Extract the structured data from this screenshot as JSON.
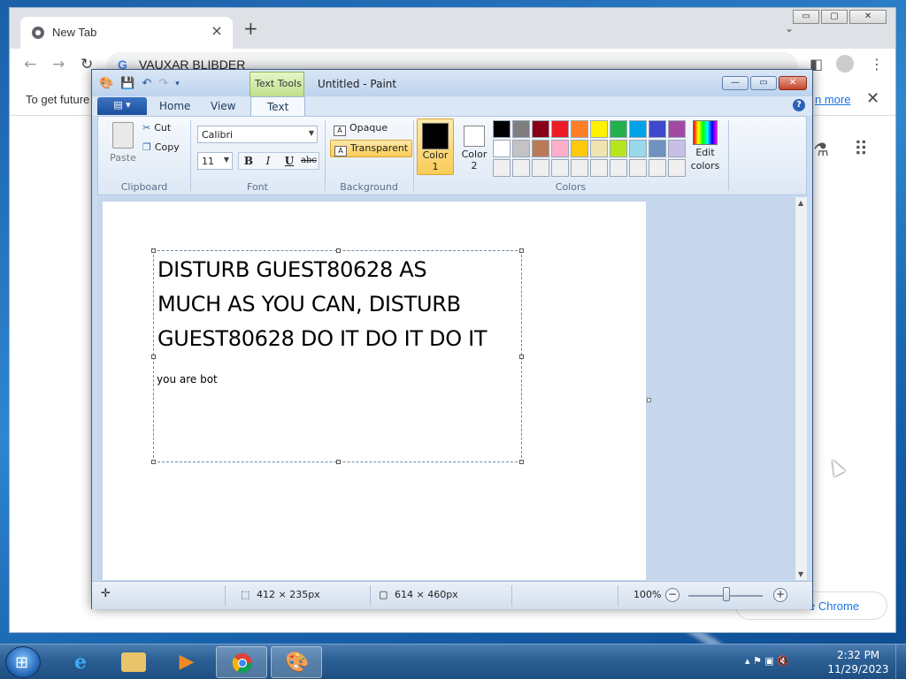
{
  "chrome": {
    "tab_title": "New Tab",
    "tab_close": "×",
    "new_tab": "+",
    "tab_search": "⌄",
    "window_controls": [
      "▭",
      "▢",
      "✕"
    ],
    "omnibox_text": "VAUXAR BLIBDER",
    "omnibox_icon": "G",
    "infobar_text": "To get future",
    "infobar_link": "n more",
    "infobar_close": "✕",
    "customize_label": "e Chrome"
  },
  "paint": {
    "window_title": "Untitled - Paint",
    "context_tab": "Text Tools",
    "file_button": "▤ ▾",
    "tabs": [
      "Home",
      "View",
      "Text"
    ],
    "active_tab": "Text",
    "help": "?",
    "window_controls": [
      "—",
      "▭",
      "✕"
    ],
    "clipboard": {
      "paste": "Paste",
      "cut": "Cut",
      "copy": "Copy",
      "label": "Clipboard"
    },
    "font": {
      "family": "Calibri",
      "size": "11",
      "bold": "B",
      "italic": "I",
      "underline": "U",
      "strikethrough": "abc",
      "label": "Font"
    },
    "background": {
      "opaque": "Opaque",
      "transparent": "Transparent",
      "selected": "Transparent",
      "label": "Background"
    },
    "colors": {
      "color1_label": [
        "Color",
        "1"
      ],
      "color2_label": [
        "Color",
        "2"
      ],
      "color1": "#000000",
      "color2": "#ffffff",
      "edit_label": [
        "Edit",
        "colors"
      ],
      "label": "Colors",
      "palette": [
        "#000000",
        "#7f7f7f",
        "#880015",
        "#ed1c24",
        "#ff7f27",
        "#fff200",
        "#22b14c",
        "#00a2e8",
        "#3f48cc",
        "#a349a4",
        "#ffffff",
        "#c3c3c3",
        "#b97a57",
        "#ffaec9",
        "#ffc90e",
        "#efe4b0",
        "#b5e61d",
        "#99d9ea",
        "#7092be",
        "#c8bfe7",
        "#f0f0f0",
        "#f0f0f0",
        "#f0f0f0",
        "#f0f0f0",
        "#f0f0f0",
        "#f0f0f0",
        "#f0f0f0",
        "#f0f0f0",
        "#f0f0f0",
        "#f0f0f0"
      ]
    },
    "canvas_text": {
      "line1": "DISTURB GUEST80628 AS",
      "line2": "MUCH AS YOU CAN, DISTURB",
      "line3": "GUEST80628 DO IT DO IT DO IT",
      "small": "you are bot"
    },
    "status": {
      "move_icon": "✛",
      "selection_size": "412 × 235px",
      "canvas_size": "614 × 460px",
      "zoom": "100%",
      "zoom_out": "−",
      "zoom_in": "+"
    }
  },
  "taskbar": {
    "time": "2:32 PM",
    "date": "11/29/2023",
    "tray_icons": "▴ ⚑ ▣ 🔇"
  }
}
